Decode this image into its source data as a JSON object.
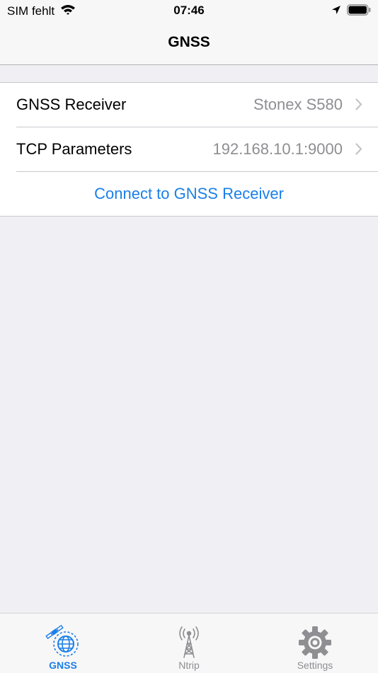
{
  "status_bar": {
    "carrier": "SIM fehlt",
    "time": "07:46",
    "icons": [
      "wifi-icon",
      "location-arrow-icon",
      "battery-icon"
    ]
  },
  "nav": {
    "title": "GNSS"
  },
  "table": {
    "rows": [
      {
        "label": "GNSS Receiver",
        "value": "Stonex S580"
      },
      {
        "label": "TCP Parameters",
        "value": "192.168.10.1:9000"
      }
    ],
    "action_label": "Connect to GNSS Receiver"
  },
  "tab_bar": {
    "tabs": [
      {
        "label": "GNSS",
        "icon": "gnss-satellite-globe-icon",
        "active": true
      },
      {
        "label": "Ntrip",
        "icon": "antenna-tower-icon",
        "active": false
      },
      {
        "label": "Settings",
        "icon": "gear-icon",
        "active": false
      }
    ]
  },
  "colors": {
    "accent": "#1a7fe8",
    "background": "#efeff4",
    "secondary_text": "#8e8e93",
    "separator": "#c8c7cc"
  }
}
